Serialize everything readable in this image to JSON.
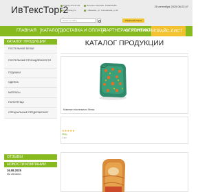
{
  "header": {
    "logo": "ИвТексТорг2",
    "phones": "8 (916) 473-97-59",
    "email": "info@ivtorg.ru",
    "shop_line1": "Интернет-магазин: Сб/Вс/Пн/Вт",
    "shop_line2": "г. Иваново, ул. Сосновская, д. 82",
    "date": "25 сентября 2025 06:22:47",
    "search_placeholder": "Поиск по сайту",
    "callback_label": "Обратный звонок"
  },
  "nav": {
    "items": [
      "ГЛАВНАЯ",
      "КАТАЛОГ",
      "ДОСТАВКА И ОПЛАТА",
      "ПАРТНЕРАМ",
      "СЕРТИФИКАТЫ",
      "КОНТАКТЫ"
    ],
    "price_list": "ПРАЙС-ЛИСТ"
  },
  "sidebar": {
    "catalog_title": "КАТАЛОГ ПРОДУКЦИИ",
    "categories": [
      "ПОСТЕЛЬНОЕ БЕЛЬЕ",
      "ПОСТЕЛЬНЫЕ ПРИНАДЛЕЖНОСТИ",
      "ПОДУШКИ",
      "ОДЕЯЛА",
      "МАТРАСЫ",
      "ПОЛОТЕНЦА",
      "СПЕЦИАЛЬНЫЕ ПРЕДЛОЖЕНИЯ"
    ],
    "reviews_title": "ОТЗЫВЫ",
    "news_title": "НОВОСТИ КОМПАНИИ",
    "news_date": "16.08.2025",
    "news_text": "Мы обновили.."
  },
  "main": {
    "title": "КАТАЛОГ ПРОДУКЦИИ",
    "product_name": "Комплект постельного белья",
    "stars": "★★★★★",
    "price": "950р.",
    "price_sub": "1 шт."
  },
  "colors": {
    "accent_green": "#86ba1e",
    "accent_yellow": "#f2c230"
  }
}
